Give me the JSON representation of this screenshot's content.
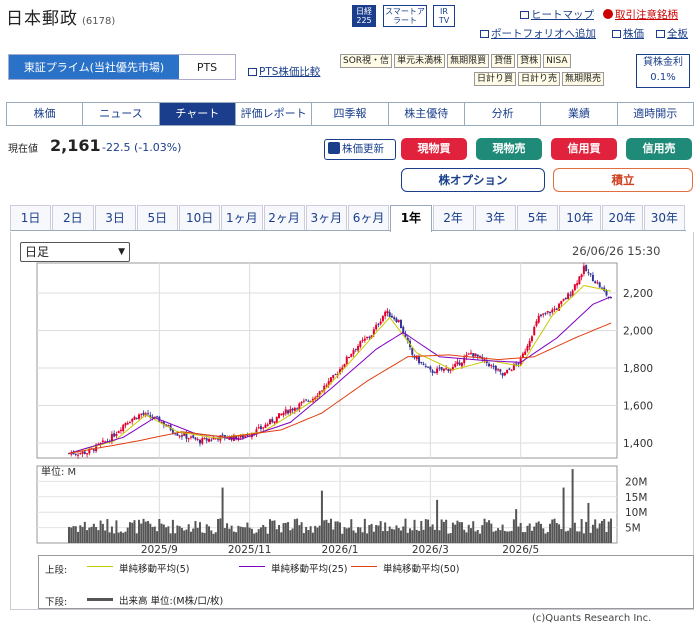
{
  "header": {
    "title": "日本郵政",
    "code": "(6178)",
    "icons": [
      "日経225",
      "スマートアラート",
      "IR TV"
    ],
    "heatmap": "ヒートマップ",
    "caution": "取引注意銘柄",
    "portfolio": "ポートフォリオへ追加",
    "price_link": "株価",
    "all_link": "全板"
  },
  "market": {
    "primary": "東証プライム(当社優先市場)",
    "pts": "PTS",
    "pts_compare": "PTS株価比較"
  },
  "tags_row1": [
    "SOR視・信",
    "単元未満株",
    "無期限買",
    "貸借",
    "貸株",
    "NISA"
  ],
  "tags_row2": [
    "日計り買",
    "日計り売",
    "無期限売"
  ],
  "lending": {
    "label": "貸株金利",
    "rate": "0.1%"
  },
  "tabs": [
    "株価",
    "ニュース",
    "チャート",
    "評価レポート",
    "四季報",
    "株主優待",
    "分析",
    "業績",
    "適時開示"
  ],
  "quote": {
    "label": "現在値",
    "price": "2,161",
    "change": "-22.5",
    "pct": "(-1.03%)",
    "refresh": "株価更新"
  },
  "buttons": {
    "buy_cash": "現物買",
    "sell_cash": "現物売",
    "buy_margin": "信用買",
    "sell_margin": "信用売",
    "option": "株オプション",
    "accum": "積立"
  },
  "periods": [
    "1日",
    "2日",
    "3日",
    "5日",
    "10日",
    "1ヶ月",
    "2ヶ月",
    "3ヶ月",
    "6ヶ月",
    "1年",
    "2年",
    "3年",
    "5年",
    "10年",
    "20年",
    "30年"
  ],
  "active_period": "1年",
  "chart_ctrl": {
    "type_select": "日足",
    "timestamp": "26/06/26 15:30",
    "vol_unit": "単位: M",
    "copyright": "(c)Quants Research Inc."
  },
  "colors": {
    "ma5": "#c8c800",
    "ma25": "#8000c0",
    "ma50": "#e04010",
    "up": "#e0002a",
    "down": "#333399",
    "volume": "#555555",
    "accent": "#1a3e8c"
  },
  "legend": {
    "upper_label": "上段:",
    "lower_label": "下段:",
    "ma5": "単純移動平均(5)",
    "ma25": "単純移動平均(25)",
    "ma50": "単純移動平均(50)",
    "volume": "出来高 単位:(M株/口/枚)"
  },
  "chart_data": {
    "type": "candlestick",
    "ylim": [
      1320,
      2360
    ],
    "yticks": [
      1400,
      1600,
      1800,
      2000,
      2200
    ],
    "ytick_labels": [
      "1,400",
      "1,600",
      "1,800",
      "2,000",
      "2,200"
    ],
    "xticks": [
      "2025/9",
      "2025/11",
      "2026/1",
      "2026/3",
      "2026/5"
    ],
    "vol_ylim": [
      0,
      25
    ],
    "vol_ticks": [
      "5M",
      "10M",
      "15M",
      "20M"
    ],
    "vol_tick_values": [
      5,
      10,
      15,
      20
    ],
    "price_anchors": [
      [
        0,
        1345
      ],
      [
        8,
        1350
      ],
      [
        18,
        1420
      ],
      [
        25,
        1510
      ],
      [
        32,
        1555
      ],
      [
        40,
        1520
      ],
      [
        48,
        1450
      ],
      [
        58,
        1410
      ],
      [
        66,
        1430
      ],
      [
        76,
        1430
      ],
      [
        84,
        1470
      ],
      [
        95,
        1560
      ],
      [
        108,
        1640
      ],
      [
        118,
        1760
      ],
      [
        126,
        1900
      ],
      [
        134,
        1980
      ],
      [
        140,
        2100
      ],
      [
        146,
        2050
      ],
      [
        152,
        1870
      ],
      [
        160,
        1780
      ],
      [
        170,
        1800
      ],
      [
        178,
        1880
      ],
      [
        186,
        1820
      ],
      [
        192,
        1760
      ],
      [
        200,
        1840
      ],
      [
        208,
        2070
      ],
      [
        216,
        2120
      ],
      [
        222,
        2200
      ],
      [
        228,
        2330
      ],
      [
        234,
        2250
      ],
      [
        240,
        2161
      ]
    ],
    "ma_anchors": {
      "ma5": [
        [
          0,
          1345
        ],
        [
          20,
          1410
        ],
        [
          34,
          1550
        ],
        [
          48,
          1460
        ],
        [
          66,
          1425
        ],
        [
          86,
          1460
        ],
        [
          110,
          1640
        ],
        [
          128,
          1880
        ],
        [
          142,
          2070
        ],
        [
          154,
          1880
        ],
        [
          170,
          1790
        ],
        [
          186,
          1840
        ],
        [
          200,
          1810
        ],
        [
          214,
          2080
        ],
        [
          228,
          2240
        ],
        [
          240,
          2210
        ]
      ],
      "ma25": [
        [
          0,
          1345
        ],
        [
          24,
          1430
        ],
        [
          38,
          1535
        ],
        [
          56,
          1450
        ],
        [
          76,
          1420
        ],
        [
          98,
          1510
        ],
        [
          116,
          1690
        ],
        [
          136,
          1900
        ],
        [
          148,
          1990
        ],
        [
          164,
          1860
        ],
        [
          184,
          1840
        ],
        [
          200,
          1830
        ],
        [
          216,
          1960
        ],
        [
          232,
          2140
        ],
        [
          240,
          2180
        ]
      ],
      "ma50": [
        [
          0,
          1345
        ],
        [
          30,
          1410
        ],
        [
          50,
          1460
        ],
        [
          70,
          1430
        ],
        [
          94,
          1470
        ],
        [
          112,
          1560
        ],
        [
          132,
          1730
        ],
        [
          150,
          1860
        ],
        [
          168,
          1870
        ],
        [
          190,
          1845
        ],
        [
          206,
          1860
        ],
        [
          224,
          1960
        ],
        [
          240,
          2040
        ]
      ]
    },
    "volume_spikes": [
      [
        68,
        18
      ],
      [
        112,
        17
      ],
      [
        163,
        14
      ],
      [
        198,
        11
      ],
      [
        219,
        18
      ],
      [
        223,
        24
      ],
      [
        230,
        13
      ]
    ]
  }
}
